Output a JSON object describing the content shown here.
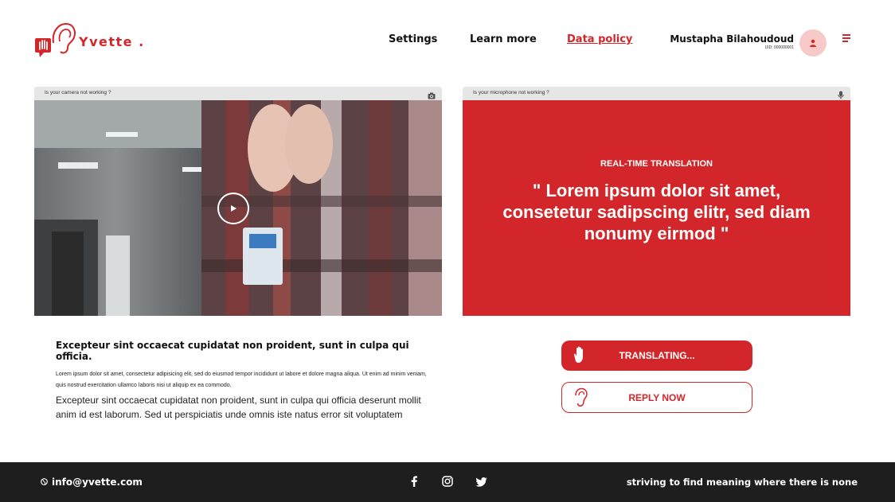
{
  "brand": {
    "name": "Yvette .",
    "accent": "#d3262a"
  },
  "nav": {
    "settings": "Settings",
    "learn_more": "Learn more",
    "data_policy": "Data policy"
  },
  "user": {
    "name": "Mustapha Bilahoudoud",
    "uid": "UID: 000000001"
  },
  "camera": {
    "help_text": "Is your camera not working ?"
  },
  "microphone": {
    "help_text": "Is your microphone not working ?"
  },
  "translation": {
    "label": "REAL-TIME TRANSLATION",
    "text": "\" Lorem ipsum dolor sit amet, consetetur sadipscing elitr, sed diam nonumy eirmod \""
  },
  "content": {
    "title": "Excepteur sint occaecat cupidatat non proident, sunt in culpa qui officia.",
    "small": "Lorem ipsum dolor sit amet, consectetur adipisicing elit, sed do eiusmod tempor incididunt ut labore et dolore magna aliqua. Ut enim ad minim veniam, quis nostrud exercitation ullamco laboris nisi ut aliquip ex ea commodo.",
    "body": "Excepteur sint occaecat cupidatat non proident, sunt in culpa qui officia deserunt mollit anim id est laborum. Sed ut perspiciatis unde omnis iste natus error sit voluptatem"
  },
  "actions": {
    "translating": "TRANSLATING...",
    "reply": "REPLY NOW"
  },
  "footer": {
    "email": "info@yvette.com",
    "tagline": "striving to find meaning where there is none"
  }
}
